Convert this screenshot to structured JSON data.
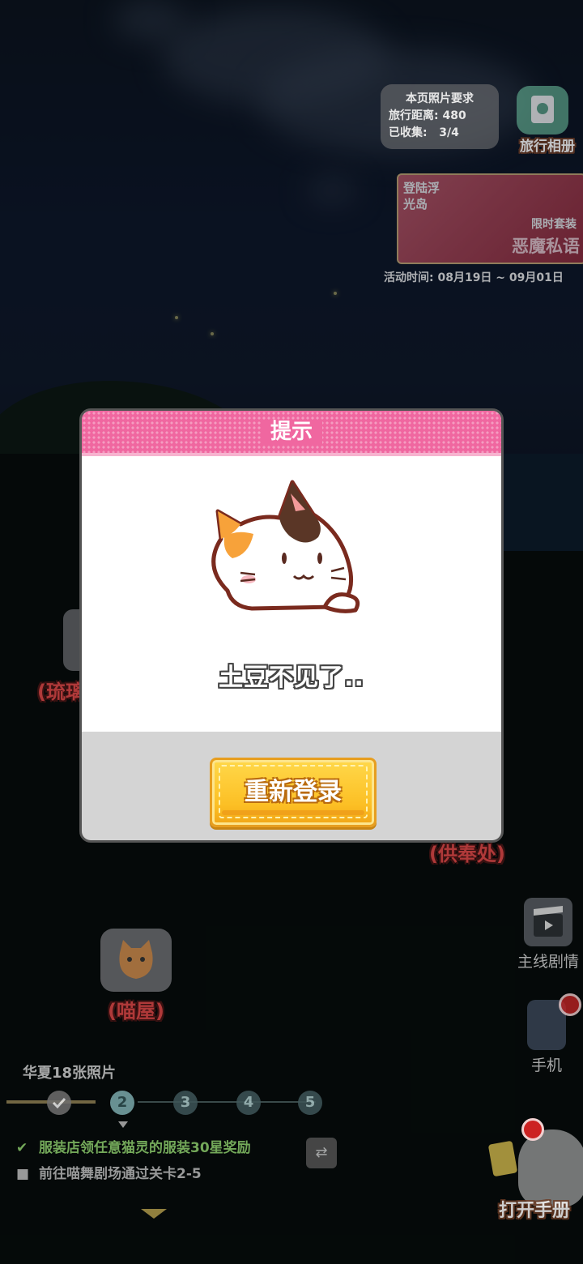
{
  "album": {
    "requirement_title": "本页照片要求",
    "distance_label": "旅行距离:",
    "distance_value": "480",
    "collected_label": "已收集:",
    "collected_value": "3/4",
    "album_label": "旅行相册"
  },
  "event": {
    "tag_login": "登陆浮光岛",
    "tag_limited": "限时套装",
    "tag_name": "恶魔私语",
    "time": "活动时间: 08月19日 ~ 09月01日"
  },
  "map": {
    "left_partial_label": "(琉璃",
    "right_partial_label": "(供奉处)",
    "meow_house_label": "(喵屋)"
  },
  "side": {
    "story_label": "主线剧情",
    "phone_label": "手机",
    "open_book_label": "打开手册"
  },
  "progress": {
    "title": "华夏18张照片",
    "nodes": [
      "2",
      "3",
      "4",
      "5"
    ]
  },
  "tasks": [
    {
      "text": "服装店领任意猫灵的服装30星奖励",
      "done": true
    },
    {
      "text": "前往喵舞剧场通过关卡2-5",
      "done": false
    }
  ],
  "dialog": {
    "title": "提示",
    "message": "土豆不见了..",
    "button": "重新登录"
  },
  "colors": {
    "dialog_header": "#f067a0",
    "button_yellow": "#fcbf24",
    "task_done": "#8fd06e"
  },
  "icons": {
    "album": "camera-icon",
    "story": "clapperboard-icon",
    "phone": "phone-icon",
    "swap": "swap-icon",
    "check": "check-icon",
    "cat": "cat-illustration"
  }
}
